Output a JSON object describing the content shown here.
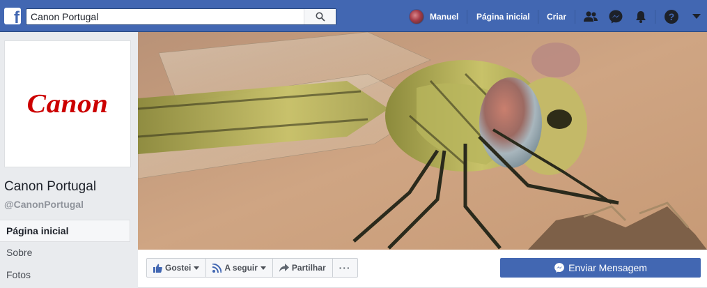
{
  "topbar": {
    "search_value": "Canon Portugal",
    "user_name": "Manuel",
    "home_label": "Página inicial",
    "create_label": "Criar",
    "bg_color": "#4267b2"
  },
  "page": {
    "logo_text": "Canon",
    "name": "Canon Portugal",
    "handle": "@CanonPortugal"
  },
  "leftnav": {
    "items": [
      {
        "label": "Página inicial",
        "active": true
      },
      {
        "label": "Sobre",
        "active": false
      },
      {
        "label": "Fotos",
        "active": false
      }
    ]
  },
  "actions": {
    "like_label": "Gostei",
    "follow_label": "A seguir",
    "share_label": "Partilhar",
    "more_label": "···",
    "message_label": "Enviar Mensagem"
  },
  "icons": [
    "facebook-icon",
    "search-icon",
    "friends-icon",
    "messenger-icon",
    "notifications-icon",
    "help-icon",
    "account-menu-icon",
    "like-icon",
    "rss-icon",
    "share-icon"
  ]
}
